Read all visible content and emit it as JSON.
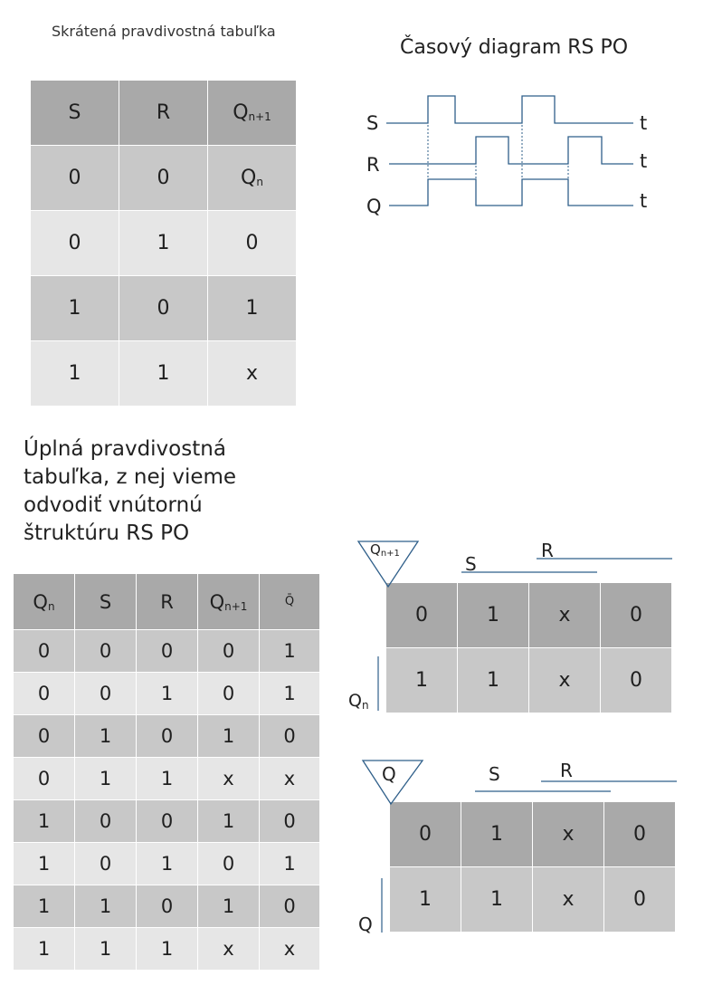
{
  "short_table": {
    "title": "Skrátená pravdivostná tabuľka",
    "header": [
      {
        "base": "S",
        "sub": ""
      },
      {
        "base": "R",
        "sub": ""
      },
      {
        "base": "Q",
        "sub": "n+1"
      }
    ],
    "rows": [
      [
        {
          "base": "0",
          "sub": ""
        },
        {
          "base": "0",
          "sub": ""
        },
        {
          "base": "Q",
          "sub": "n"
        }
      ],
      [
        {
          "base": "0",
          "sub": ""
        },
        {
          "base": "1",
          "sub": ""
        },
        {
          "base": "0",
          "sub": ""
        }
      ],
      [
        {
          "base": "1",
          "sub": ""
        },
        {
          "base": "0",
          "sub": ""
        },
        {
          "base": "1",
          "sub": ""
        }
      ],
      [
        {
          "base": "1",
          "sub": ""
        },
        {
          "base": "1",
          "sub": ""
        },
        {
          "base": "x",
          "sub": ""
        }
      ]
    ]
  },
  "timing_diagram": {
    "title": "Časový diagram RS PO",
    "signals": [
      "S",
      "R",
      "Q"
    ],
    "time_label": "t"
  },
  "full_table": {
    "title": "Úplná pravdivostná tabuľka, z nej vieme odvodiť vnútornú štruktúru RS PO",
    "header": [
      {
        "base": "Q",
        "sub": "n"
      },
      {
        "base": "S",
        "sub": ""
      },
      {
        "base": "R",
        "sub": ""
      },
      {
        "base": "Q",
        "sub": "n+1"
      },
      {
        "base": "Q̄",
        "sub": ""
      }
    ],
    "rows": [
      [
        "0",
        "0",
        "0",
        "0",
        "1"
      ],
      [
        "0",
        "0",
        "1",
        "0",
        "1"
      ],
      [
        "0",
        "1",
        "0",
        "1",
        "0"
      ],
      [
        "0",
        "1",
        "1",
        "x",
        "x"
      ],
      [
        "1",
        "0",
        "0",
        "1",
        "0"
      ],
      [
        "1",
        "0",
        "1",
        "0",
        "1"
      ],
      [
        "1",
        "1",
        "0",
        "1",
        "0"
      ],
      [
        "1",
        "1",
        "1",
        "x",
        "x"
      ]
    ]
  },
  "kmap1": {
    "corner": {
      "base": "Q",
      "sub": "n+1"
    },
    "col_var_s": "S",
    "col_var_r": "R",
    "row_var": {
      "base": "Q",
      "sub": "n"
    },
    "rows": [
      [
        "0",
        "1",
        "x",
        "0"
      ],
      [
        "1",
        "1",
        "x",
        "0"
      ]
    ]
  },
  "kmap2": {
    "corner": "Q",
    "col_var_s": "S",
    "col_var_r": "R",
    "row_var": "Q",
    "rows": [
      [
        "0",
        "1",
        "x",
        "0"
      ],
      [
        "1",
        "1",
        "x",
        "0"
      ]
    ]
  },
  "colors": {
    "diagram_line": "#2f5f8a",
    "table_dark": "#a9a9a9",
    "table_mid": "#c8c8c8",
    "table_light": "#e6e6e6"
  }
}
